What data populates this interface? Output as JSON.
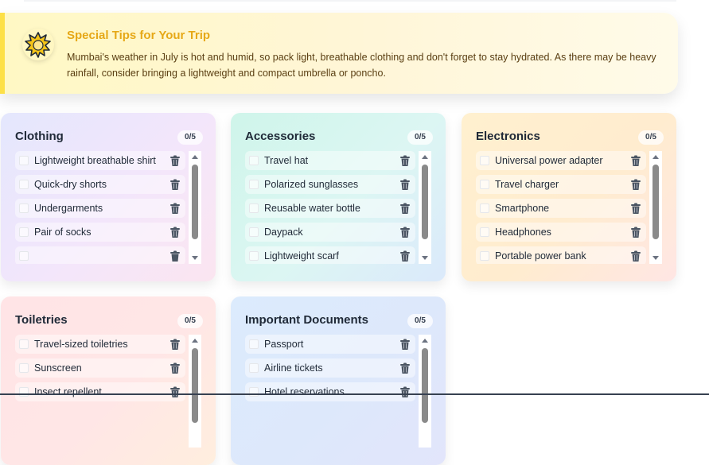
{
  "tips": {
    "title": "Special Tips for Your Trip",
    "text": "Mumbai's weather in July is hot and humid, so pack light, breathable clothing and don't forget to stay hydrated. As there may be heavy rainfall, consider bringing a lightweight and compact umbrella or poncho.",
    "icon": "sun-burst-icon"
  },
  "categories": [
    {
      "title": "Clothing",
      "count": "0/5",
      "items": [
        "Lightweight breathable shirt",
        "Quick-dry shorts",
        "Undergarments",
        "Pair of socks",
        ""
      ]
    },
    {
      "title": "Accessories",
      "count": "0/5",
      "items": [
        "Travel hat",
        "Polarized sunglasses",
        "Reusable water bottle",
        "Daypack",
        "Lightweight scarf"
      ]
    },
    {
      "title": "Electronics",
      "count": "0/5",
      "items": [
        "Universal power adapter",
        "Travel charger",
        "Smartphone",
        "Headphones",
        "Portable power bank"
      ]
    },
    {
      "title": "Toiletries",
      "count": "0/5",
      "items": [
        "Travel-sized toiletries",
        "Sunscreen",
        "Insect repellent"
      ]
    },
    {
      "title": "Important Documents",
      "count": "0/5",
      "items": [
        "Passport",
        "Airline tickets",
        "Hotel reservations"
      ]
    }
  ],
  "colors": {
    "tips_title": "#e6a817",
    "tips_accent": "#fde047",
    "trash": "#4b5563",
    "scroll_thumb": "#8a8a8a"
  }
}
